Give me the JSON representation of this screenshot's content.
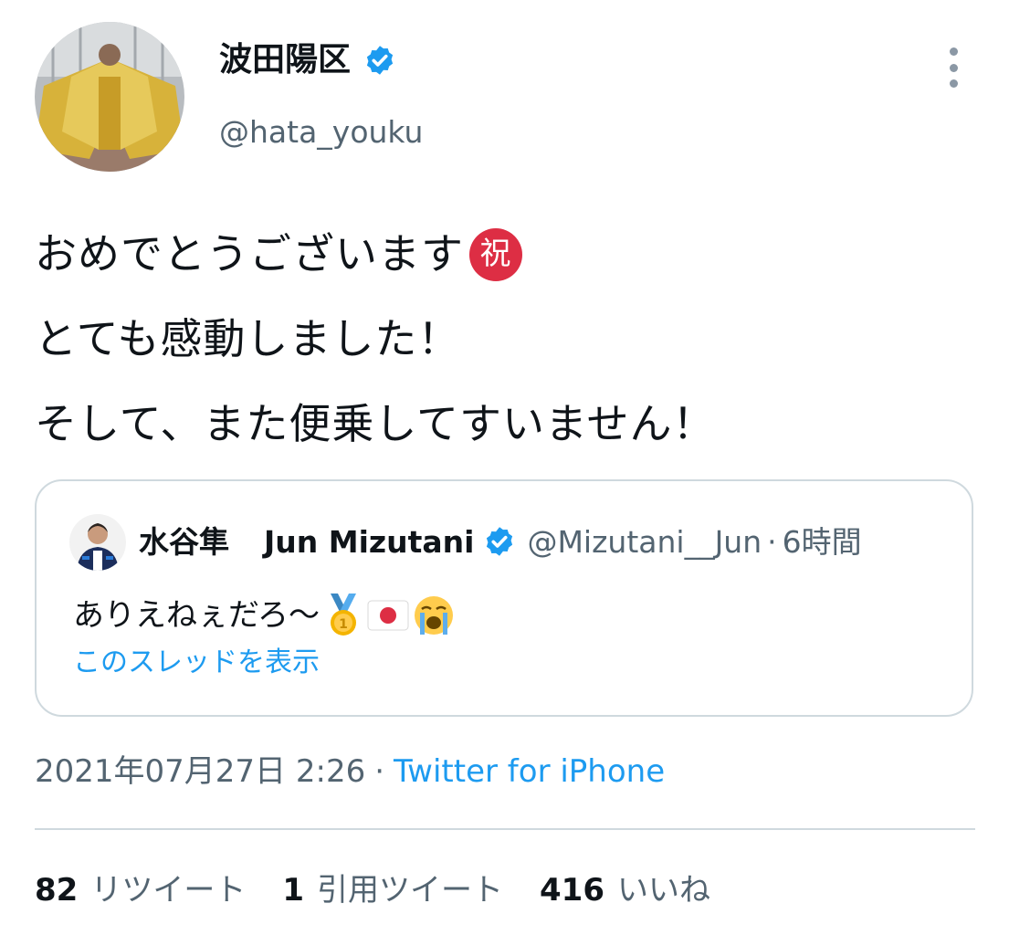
{
  "author": {
    "display_name": "波田陽区",
    "handle": "@hata_youku"
  },
  "tweet": {
    "lines": [
      "おめでとうございます",
      "とても感動しました！",
      "そして、また便乗してすいません！"
    ],
    "emoji_char": "祝"
  },
  "quote": {
    "display_name_jp": "水谷隼",
    "display_name_en": "Jun Mizutani",
    "handle": "@Mizutani__Jun",
    "separator": "·",
    "time": "6時間",
    "text": "ありえねぇだろ〜",
    "emojis": [
      "gold-medal-icon",
      "japan-flag-icon",
      "crying-face-icon"
    ],
    "thread_link": "このスレッドを表示"
  },
  "meta": {
    "timestamp": "2021年07月27日 2:26",
    "separator": "·",
    "source": "Twitter for iPhone"
  },
  "stats": [
    {
      "count": "82",
      "label": "リツイート"
    },
    {
      "count": "1",
      "label": "引用ツイート"
    },
    {
      "count": "416",
      "label": "いいね"
    }
  ],
  "colors": {
    "accent": "#1d9bf0",
    "secondary_text": "#536471",
    "border": "#cfd9de",
    "iwai_red": "#dd2e44"
  }
}
